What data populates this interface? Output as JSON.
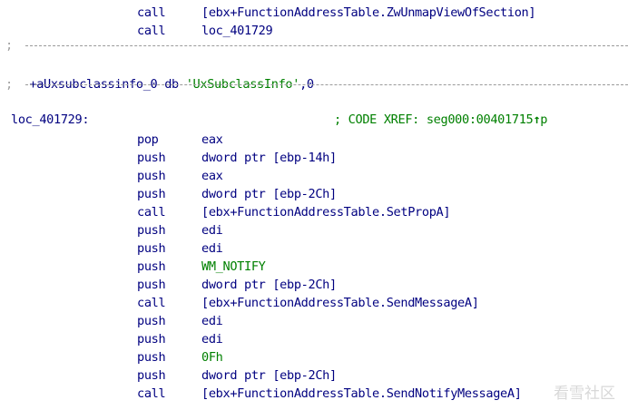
{
  "top_lines": [
    {
      "mnemonic": "call",
      "operand": "[ebx+FunctionAddressTable.ZwUnmapViewOfSection]"
    },
    {
      "mnemonic": "call",
      "operand": "loc_401729"
    }
  ],
  "separator": ";",
  "data_line": {
    "prefix": "+",
    "label": "aUxsubclassinfo_0 db ",
    "string": "'UxSubclassInfo'",
    "suffix": ",0"
  },
  "loc_label": "loc_401729:",
  "xref": {
    "text": "; CODE XREF: seg000:00401715",
    "arrow": "↑",
    "suffix": "p"
  },
  "instructions": [
    {
      "mnemonic": "pop",
      "operand": "eax"
    },
    {
      "mnemonic": "push",
      "operand": "dword ptr [ebp-14h]"
    },
    {
      "mnemonic": "push",
      "operand": "eax"
    },
    {
      "mnemonic": "push",
      "operand": "dword ptr [ebp-2Ch]"
    },
    {
      "mnemonic": "call",
      "operand": "[ebx+FunctionAddressTable.SetPropA]"
    },
    {
      "mnemonic": "push",
      "operand": "edi"
    },
    {
      "mnemonic": "push",
      "operand": "edi"
    },
    {
      "mnemonic": "push",
      "operand": "WM_NOTIFY"
    },
    {
      "mnemonic": "push",
      "operand": "dword ptr [ebp-2Ch]"
    },
    {
      "mnemonic": "call",
      "operand": "[ebx+FunctionAddressTable.SendMessageA]"
    },
    {
      "mnemonic": "push",
      "operand": "edi"
    },
    {
      "mnemonic": "push",
      "operand": "edi"
    },
    {
      "mnemonic": "push",
      "operand": "0Fh"
    },
    {
      "mnemonic": "push",
      "operand": "dword ptr [ebp-2Ch]"
    },
    {
      "mnemonic": "call",
      "operand": "[ebx+FunctionAddressTable.SendNotifyMessageA]"
    }
  ],
  "watermark": "看雪社区",
  "colors": {
    "code": "#000080",
    "constant": "#008000",
    "comment": "#008000",
    "separator": "#a0a0a0",
    "background": "#ffffff"
  }
}
